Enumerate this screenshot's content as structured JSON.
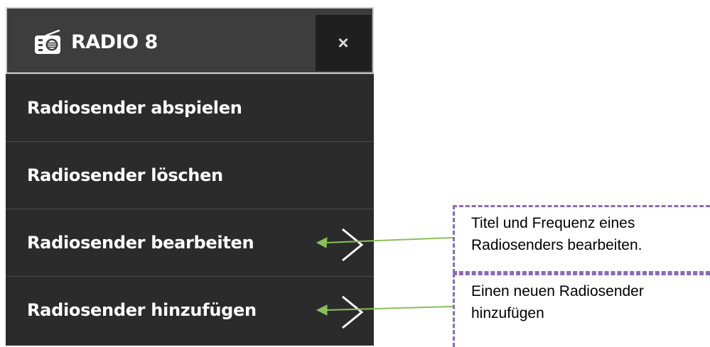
{
  "header": {
    "title": "RADIO 8",
    "icon": "radio-icon",
    "close_label": "×"
  },
  "menu": {
    "items": [
      {
        "label": "Radiosender abspielen",
        "has_submenu": false
      },
      {
        "label": "Radiosender löschen",
        "has_submenu": false
      },
      {
        "label": "Radiosender bearbeiten",
        "has_submenu": true
      },
      {
        "label": "Radiosender hinzufügen",
        "has_submenu": true
      }
    ]
  },
  "callouts": [
    {
      "line1": "Titel und Frequenz eines",
      "line2": "Radiosenders bearbeiten."
    },
    {
      "line1": "Einen neuen Radiosender",
      "line2": "hinzufügen"
    }
  ],
  "colors": {
    "menu_background": "#2b2b2b",
    "header_background": "#3d3d3d",
    "close_background": "#1f1f1f",
    "arrow": "#8bbf5a",
    "callout_border": "#8a6bb8"
  }
}
